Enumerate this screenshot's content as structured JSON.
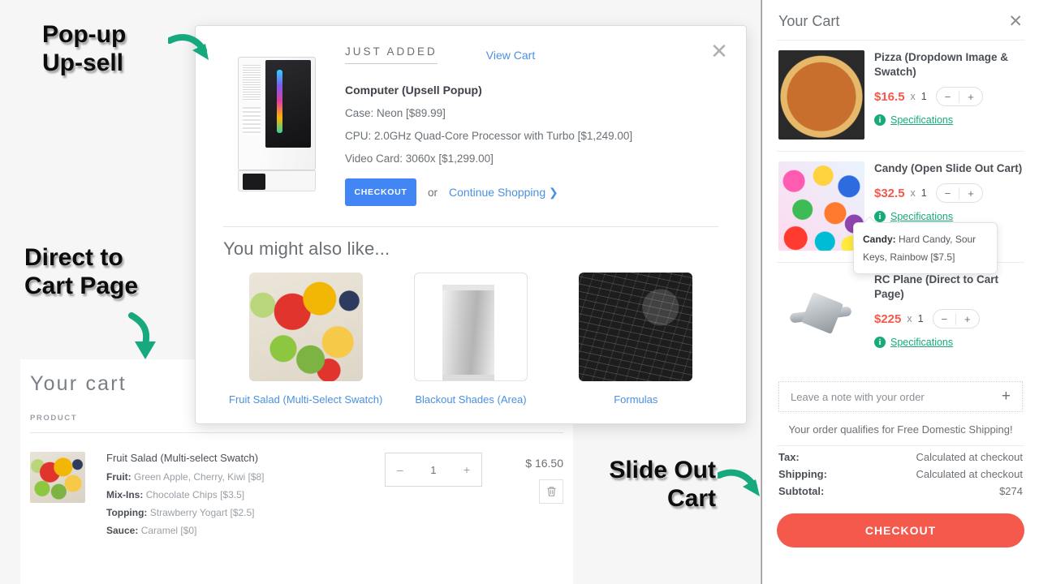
{
  "annotations": [
    {
      "id": "popup-upsell",
      "line1": "Pop-up",
      "line2": "Up-sell"
    },
    {
      "id": "direct-cart",
      "line1": "Direct to",
      "line2": "Cart Page"
    },
    {
      "id": "slide-out",
      "line1": "Slide Out",
      "line2": "Cart"
    }
  ],
  "popup": {
    "badge": "JUST ADDED",
    "view_cart": "View Cart",
    "close_icon": "✕",
    "product_title": "Computer (Upsell Popup)",
    "options": [
      "Case: Neon [$89.99]",
      "CPU: 2.0GHz Quad-Core Processor with Turbo [$1,249.00]",
      "Video Card: 3060x [$1,299.00]"
    ],
    "checkout_label": "CHECKOUT",
    "or_label": "or",
    "continue_label": "Continue Shopping ❯",
    "recs_title": "You might also like...",
    "recommendations": [
      {
        "label": "Fruit Salad (Multi-Select Swatch)",
        "image": "fruit-salad-image"
      },
      {
        "label": "Blackout Shades (Area)",
        "image": "blackout-shades-image"
      },
      {
        "label": "Formulas",
        "image": "formulas-image"
      }
    ]
  },
  "cart_page": {
    "title": "Your cart",
    "column_header": "PRODUCT",
    "row": {
      "name": "Fruit Salad (Multi-select Swatch)",
      "options": [
        {
          "label": "Fruit:",
          "value": "Green Apple, Cherry, Kiwi [$8]"
        },
        {
          "label": "Mix-Ins:",
          "value": "Chocolate Chips [$3.5]"
        },
        {
          "label": "Topping:",
          "value": "Strawberry Yogart [$2.5]"
        },
        {
          "label": "Sauce:",
          "value": "Caramel [$0]"
        }
      ],
      "minus": "–",
      "qty": "1",
      "plus": "+",
      "price": "$ 16.50",
      "remove_icon": "🗑"
    }
  },
  "slide_cart": {
    "title": "Your Cart",
    "close_icon": "✕",
    "items": [
      {
        "name": "Pizza (Dropdown Image & Swatch)",
        "price": "$16.5",
        "times": "x",
        "qty": "1",
        "minus": "−",
        "plus": "+",
        "specs_label": "Specifications",
        "info_icon": "i",
        "image": "pizza-image"
      },
      {
        "name": "Candy (Open Slide Out Cart)",
        "price": "$32.5",
        "times": "x",
        "qty": "1",
        "minus": "−",
        "plus": "+",
        "specs_label": "Specifications",
        "info_icon": "i",
        "image": "candy-image"
      },
      {
        "name": "RC Plane (Direct to Cart Page)",
        "price": "$225",
        "times": "x",
        "qty": "1",
        "minus": "−",
        "plus": "+",
        "specs_label": "Specifications",
        "info_icon": "i",
        "image": "rc-plane-image"
      }
    ],
    "tooltip": {
      "label": "Candy:",
      "value": " Hard Candy, Sour Keys, Rainbow [$7.5]"
    },
    "note_placeholder": "Leave a note with your order",
    "note_plus": "+",
    "free_shipping": "Your order qualifies for Free Domestic Shipping!",
    "totals": [
      {
        "label": "Tax:",
        "value": "Calculated at checkout"
      },
      {
        "label": "Shipping:",
        "value": "Calculated at checkout"
      },
      {
        "label": "Subtotal:",
        "value": "$274"
      }
    ],
    "checkout_label": "CHECKOUT"
  },
  "colors": {
    "accent_blue": "#4285f4",
    "accent_red": "#f4594c",
    "accent_green": "#17ab7c",
    "arrow_green": "#17a97e",
    "page_bg": "#f6f6f6"
  }
}
